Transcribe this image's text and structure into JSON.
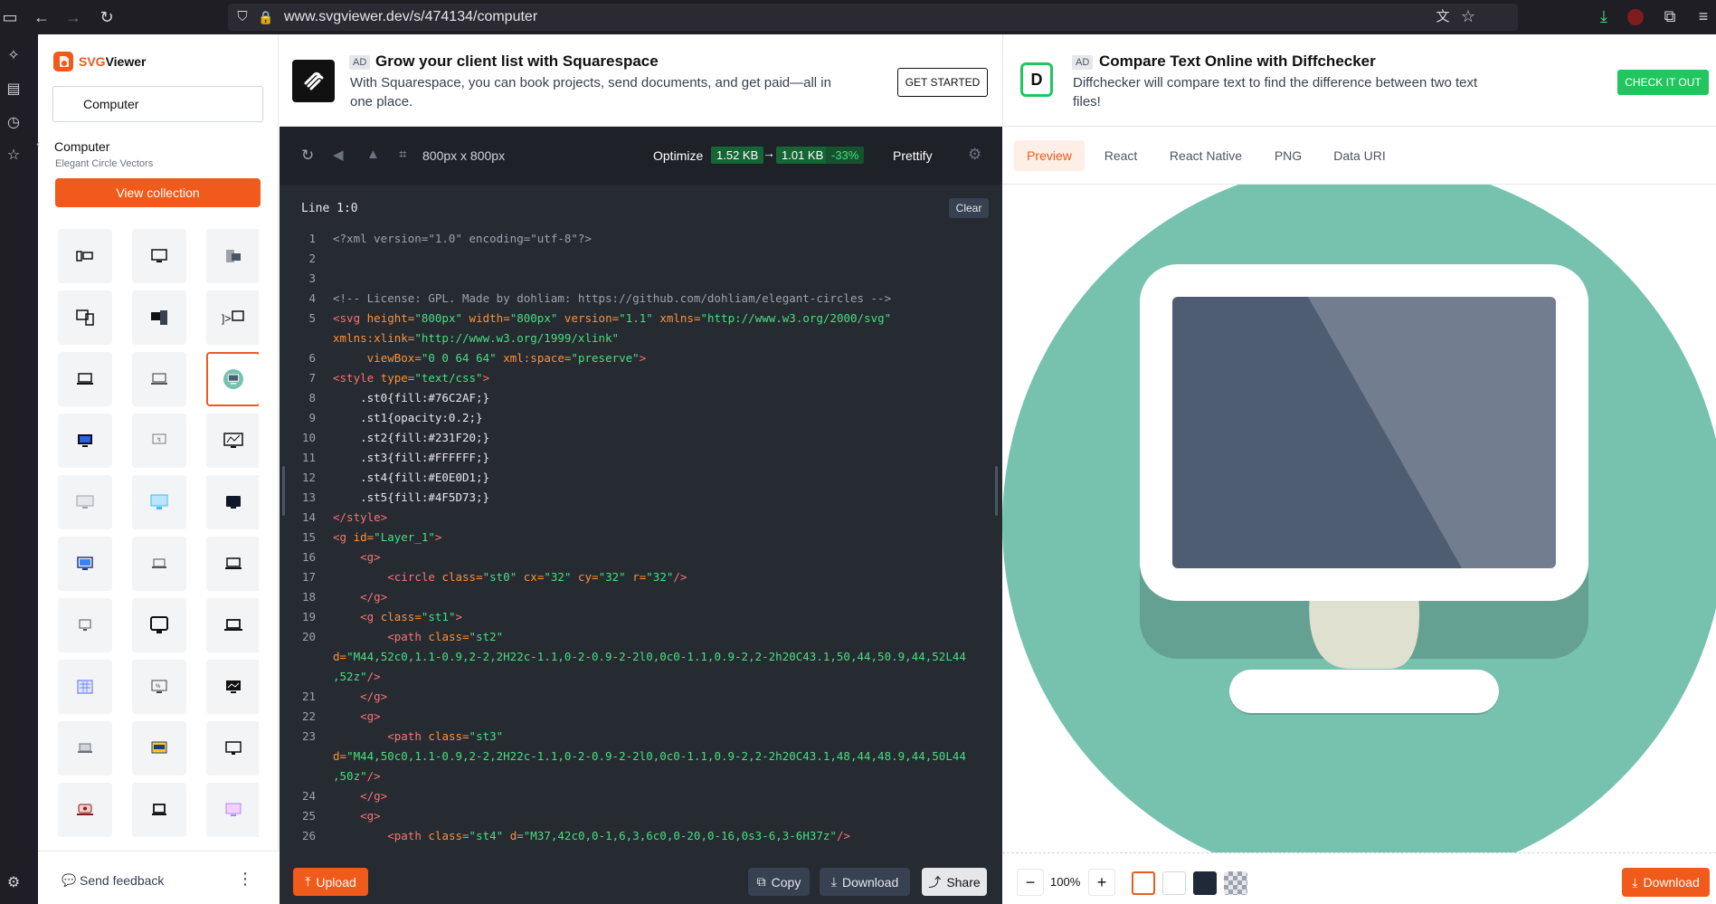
{
  "browser": {
    "url": "www.svgviewer.dev/s/474134/computer"
  },
  "sidebar": {
    "brand_svg": "SVG",
    "brand_viewer": "Viewer",
    "search_value": "Computer",
    "collection_title": "Computer",
    "collection_subtitle": "Elegant Circle Vectors",
    "view_collection_label": "View collection",
    "feedback_label": "Send feedback"
  },
  "ads": {
    "left": {
      "badge": "AD",
      "title": "Grow your client list with Squarespace",
      "body": "With Squarespace, you can book projects, send documents, and get paid—all in one place.",
      "cta": "GET STARTED"
    },
    "right": {
      "badge": "AD",
      "title": "Compare Text Online with Diffchecker",
      "body": "Diffchecker will compare text to find the difference between two text files!",
      "cta": "CHECK IT OUT"
    }
  },
  "editor": {
    "dimensions": "800px x 800px",
    "optimize_label": "Optimize",
    "size_before": "1.52 KB",
    "size_after": "1.01 KB",
    "size_reduction": "-33%",
    "prettify_label": "Prettify",
    "line_indicator": "Line 1:0",
    "clear_label": "Clear",
    "upload_label": "Upload",
    "copy_label": "Copy",
    "download_label": "Download",
    "share_label": "Share",
    "line_numbers": [
      "1",
      "2",
      "3",
      "4",
      "5",
      "",
      "6",
      "7",
      "8",
      "9",
      "10",
      "11",
      "12",
      "13",
      "14",
      "15",
      "16",
      "17",
      "18",
      "19",
      "20",
      "",
      "",
      "21",
      "22",
      "23",
      "",
      "",
      "24",
      "25",
      "26"
    ]
  },
  "preview": {
    "tabs": [
      "Preview",
      "React",
      "React Native",
      "PNG",
      "Data URI"
    ],
    "zoom": "100%",
    "download_label": "Download"
  },
  "colors": {
    "accent": "#f05a1a",
    "st0": "#76C2AF",
    "st2": "#231F20",
    "st3": "#FFFFFF",
    "st4": "#E0E0D1",
    "st5": "#4F5D73"
  }
}
